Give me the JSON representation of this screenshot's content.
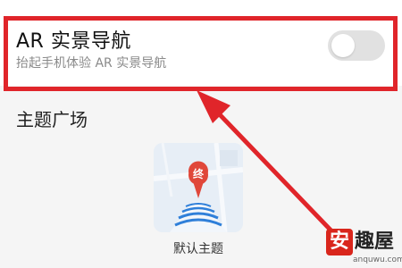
{
  "ar_navigation": {
    "title": "AR 实景导航",
    "subtitle": "抬起手机体验 AR 实景导航",
    "toggle_on": false
  },
  "theme_plaza": {
    "section_title": "主题广场",
    "themes": [
      {
        "label": "默认主题",
        "marker_text": "终"
      }
    ]
  },
  "watermark": {
    "badge_char": "安",
    "brand": "趣屋",
    "url": "anquwu.com"
  },
  "colors": {
    "highlight": "#e0252a",
    "accent_red": "#e0473a",
    "toggle_off": "#e1e1e1"
  }
}
